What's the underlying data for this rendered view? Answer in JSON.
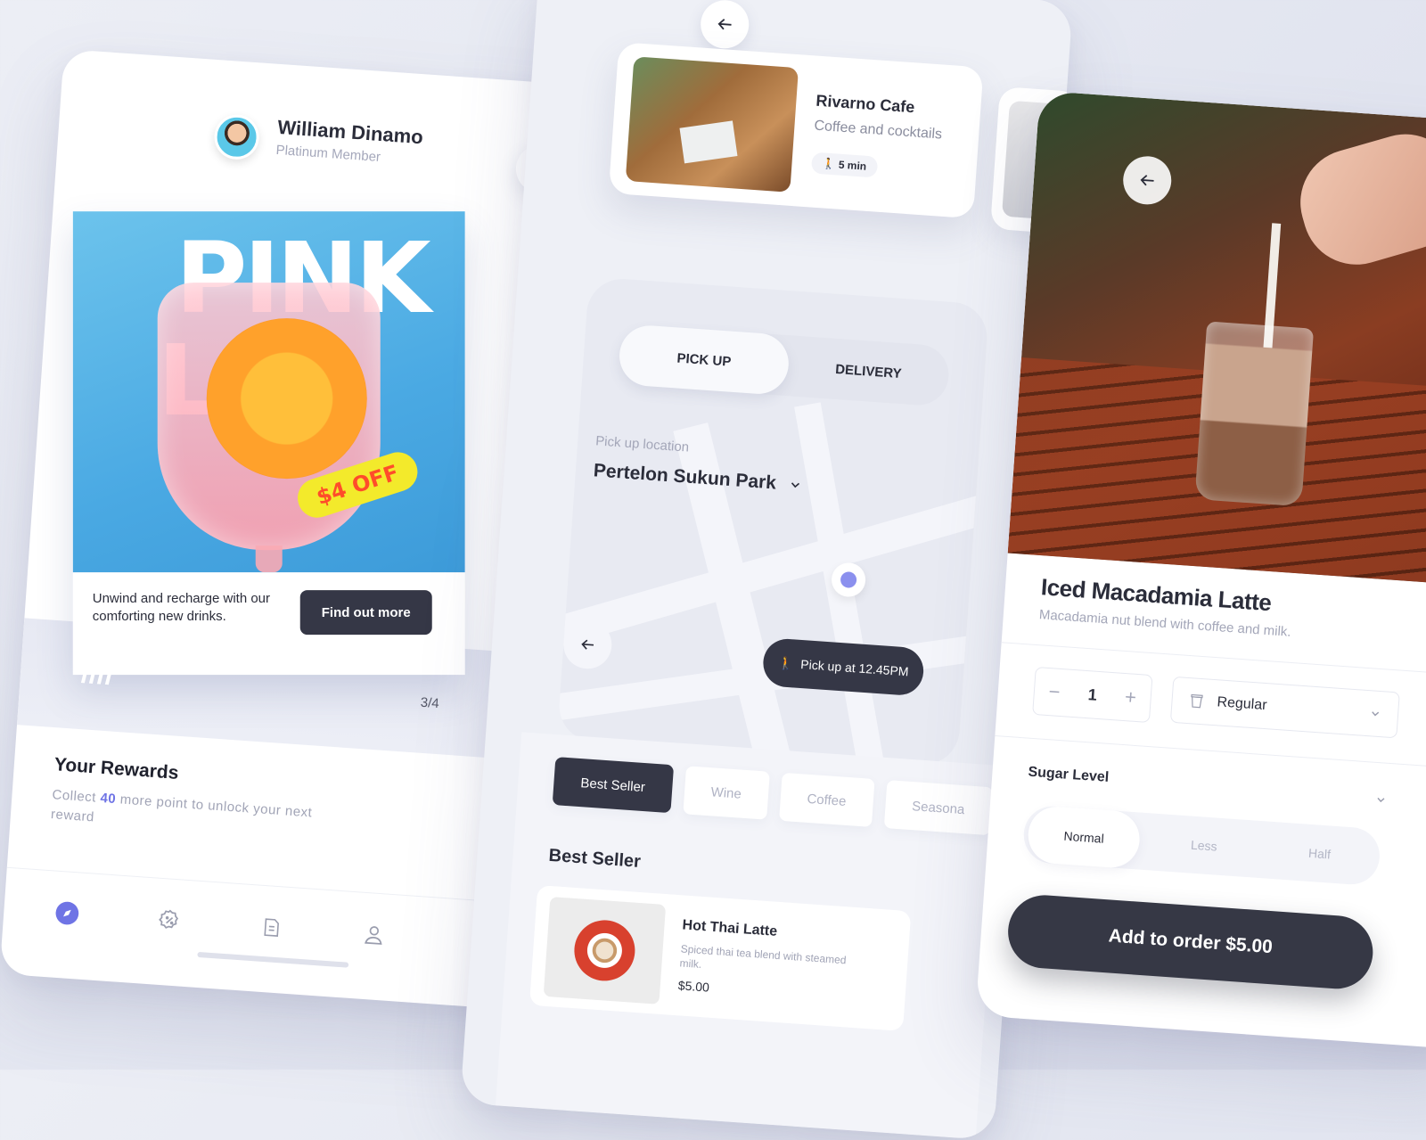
{
  "phone1": {
    "user": {
      "name": "William Dinamo",
      "tier": "Platinum Member"
    },
    "promo": {
      "headline_line1": "PINK",
      "headline_line2": "L   A",
      "badge": "$4 OFF",
      "text": "Unwind and recharge with our comforting new drinks.",
      "button": "Find out more",
      "page_indicator": "3/4"
    },
    "rewards": {
      "title": "Your Rewards",
      "desc_prefix": "Collect ",
      "points": "40",
      "desc_suffix": " more point to unlock your next reward"
    },
    "tabs": [
      "compass-icon",
      "discount-icon",
      "receipt-icon",
      "profile-icon"
    ]
  },
  "phone2": {
    "cafe": {
      "name": "Rivarno Cafe",
      "subtitle": "Coffee and cocktails",
      "time": "5 min"
    },
    "segment": {
      "pickup": "PICK UP",
      "delivery": "DELIVERY"
    },
    "location": {
      "label": "Pick up location",
      "value": "Pertelon Sukun Park"
    },
    "pickup_time": "Pick up at 12.45PM",
    "categories": [
      "Best Seller",
      "Wine",
      "Coffee",
      "Seasona"
    ],
    "section_title": "Best Seller",
    "product": {
      "name": "Hot Thai Latte",
      "desc": "Spiced thai tea blend with steamed milk.",
      "price": "$5.00"
    }
  },
  "phone3": {
    "name": "Iced Macadamia Latte",
    "desc": "Macadamia nut blend with coffee and milk.",
    "quantity": "1",
    "size": "Regular",
    "sugar": {
      "title": "Sugar Level",
      "options": [
        "Normal",
        "Less",
        "Half"
      ]
    },
    "add_button": "Add to order $5.00"
  },
  "colors": {
    "dark": "#353746",
    "accent": "#6f74e5",
    "badge_yellow": "#f3ea2b",
    "badge_text": "#ff4c2a"
  }
}
